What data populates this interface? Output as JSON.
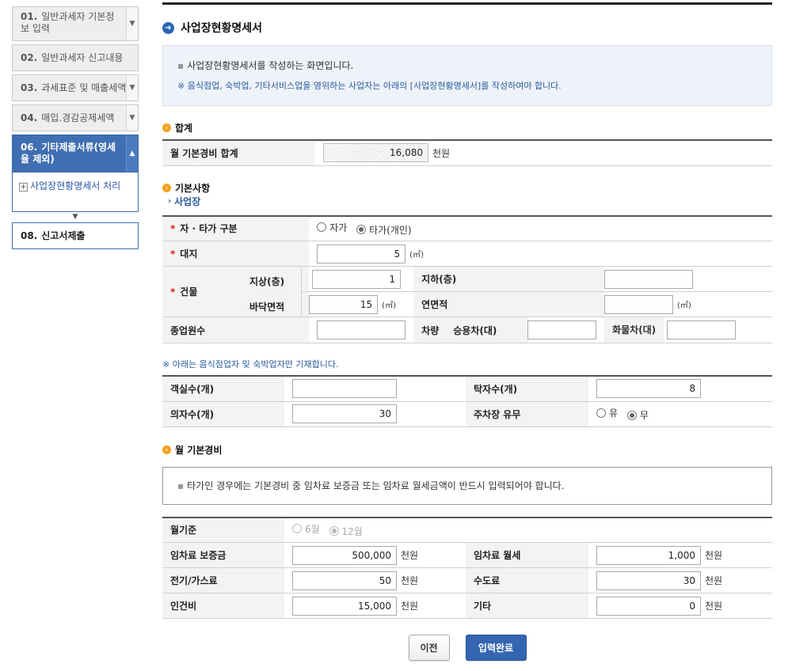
{
  "sidebar": {
    "steps": [
      {
        "num": "01.",
        "label": "일반과세자 기본정보 입력"
      },
      {
        "num": "02.",
        "label": "일반과세자 신고내용"
      },
      {
        "num": "03.",
        "label": "과세표준 및 매출세액"
      },
      {
        "num": "04.",
        "label": "매입.경감공제세액"
      },
      {
        "num": "06.",
        "label": "기타제출서류(영세율 제외)"
      }
    ],
    "substep_label": "사업장현황명세서 처리",
    "submit": {
      "num": "08.",
      "label": "신고서제출"
    }
  },
  "page": {
    "title": "사업장현황명세서",
    "info_line1": "사업장현황명세서를 작성하는 화면입니다.",
    "info_line2": "※ 음식점업, 숙박업, 기타서비스업을 영위하는 사업자는 아래의 [사업장현황명세서]를 작성하여야 합니다."
  },
  "total": {
    "section": "합계",
    "label": "월 기본경비 합계",
    "value": "16,080",
    "unit": "천원"
  },
  "basic": {
    "section": "기본사항",
    "subsection": "사업장",
    "ownership_label": "자 · 타가 구분",
    "ownership_options": [
      "자가",
      "타가(개인)"
    ],
    "land_label": "대지",
    "land_value": "5",
    "sqm": "(㎡)",
    "building_label": "건물",
    "floors_above_label": "지상(층)",
    "floors_above_value": "1",
    "floors_below_label": "지하(층)",
    "floors_below_value": "",
    "floor_area_label": "바닥면적",
    "floor_area_value": "15",
    "total_area_label": "연면적",
    "total_area_value": "",
    "employees_label": "종업원수",
    "employees_value": "",
    "vehicles_label": "차량",
    "car_label": "승용차(대)",
    "car_value": "",
    "truck_label": "화물차(대)",
    "truck_value": ""
  },
  "restaurant": {
    "note": "※ 아래는 음식점업자 및 숙박업자만 기재합니다.",
    "rooms_label": "객실수(개)",
    "rooms_value": "",
    "tables_label": "탁자수(개)",
    "tables_value": "8",
    "chairs_label": "의자수(개)",
    "chairs_value": "30",
    "parking_label": "주차장 유무",
    "parking_options": [
      "유",
      "무"
    ]
  },
  "monthly": {
    "section": "월 기본경비",
    "notice": "타가인 경우에는 기본경비 중 임차료 보증금 또는 임차료 월세금액이 반드시 입력되어야 합니다.",
    "basis_label": "월기준",
    "basis_options": [
      "6월",
      "12월"
    ],
    "deposit_label": "임차료 보증금",
    "deposit_value": "500,000",
    "rent_label": "임차료 월세",
    "rent_value": "1,000",
    "utility_label": "전기/가스료",
    "utility_value": "50",
    "water_label": "수도료",
    "water_value": "30",
    "labor_label": "인건비",
    "labor_value": "15,000",
    "other_label": "기타",
    "other_value": "0",
    "unit": "천원"
  },
  "buttons": {
    "prev": "이전",
    "done": "입력완료"
  }
}
